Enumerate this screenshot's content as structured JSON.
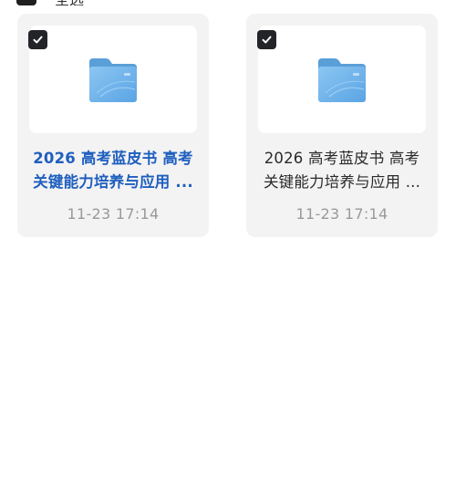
{
  "header": {
    "select_all_text": "全选"
  },
  "files": [
    {
      "name_line1": "2026 高考蓝皮书 高考",
      "name_line2": "关键能力培养与应用 ...",
      "time": "11-23 17:14",
      "selected": true,
      "highlighted": true,
      "icon": "folder-icon"
    },
    {
      "name_line1": "2026 高考蓝皮书 高考",
      "name_line2": "关键能力培养与应用 ...",
      "time": "11-23 17:14",
      "selected": true,
      "highlighted": false,
      "icon": "folder-icon"
    }
  ],
  "colors": {
    "card_bg": "#f3f3f3",
    "highlight_text": "#1f5fbf",
    "checkbox": "#222428",
    "folder": "#6fb2ea"
  }
}
